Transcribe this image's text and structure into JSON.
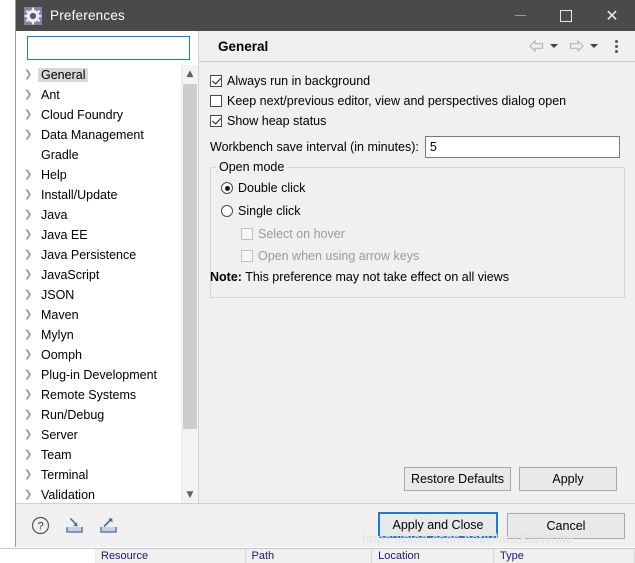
{
  "window": {
    "title": "Preferences",
    "icon": "gear-icon",
    "controls": {
      "minimize": "minimize-icon",
      "maximize": "maximize-icon",
      "close": "close-icon"
    }
  },
  "sidebar": {
    "filter": {
      "value": "",
      "placeholder": ""
    },
    "items": [
      {
        "label": "General",
        "expandable": true,
        "selected": true
      },
      {
        "label": "Ant",
        "expandable": true,
        "selected": false
      },
      {
        "label": "Cloud Foundry",
        "expandable": true,
        "selected": false
      },
      {
        "label": "Data Management",
        "expandable": true,
        "selected": false
      },
      {
        "label": "Gradle",
        "expandable": false,
        "selected": false
      },
      {
        "label": "Help",
        "expandable": true,
        "selected": false
      },
      {
        "label": "Install/Update",
        "expandable": true,
        "selected": false
      },
      {
        "label": "Java",
        "expandable": true,
        "selected": false
      },
      {
        "label": "Java EE",
        "expandable": true,
        "selected": false
      },
      {
        "label": "Java Persistence",
        "expandable": true,
        "selected": false
      },
      {
        "label": "JavaScript",
        "expandable": true,
        "selected": false
      },
      {
        "label": "JSON",
        "expandable": true,
        "selected": false
      },
      {
        "label": "Maven",
        "expandable": true,
        "selected": false
      },
      {
        "label": "Mylyn",
        "expandable": true,
        "selected": false
      },
      {
        "label": "Oomph",
        "expandable": true,
        "selected": false
      },
      {
        "label": "Plug-in Development",
        "expandable": true,
        "selected": false
      },
      {
        "label": "Remote Systems",
        "expandable": true,
        "selected": false
      },
      {
        "label": "Run/Debug",
        "expandable": true,
        "selected": false
      },
      {
        "label": "Server",
        "expandable": true,
        "selected": false
      },
      {
        "label": "Team",
        "expandable": true,
        "selected": false
      },
      {
        "label": "Terminal",
        "expandable": true,
        "selected": false
      },
      {
        "label": "Validation",
        "expandable": true,
        "selected": false
      }
    ],
    "scrollbar": {
      "up_arrow": "chevron-up-icon",
      "down_arrow": "chevron-down-icon"
    }
  },
  "page": {
    "title": "General",
    "nav": {
      "back": "back-arrow-icon",
      "back_menu": "chevron-down-icon",
      "forward": "forward-arrow-icon",
      "forward_menu": "chevron-down-icon",
      "menu": "kebab-menu-icon"
    },
    "checkboxes": [
      {
        "label": "Always run in background",
        "checked": true,
        "enabled": true
      },
      {
        "label": "Keep next/previous editor, view and perspectives dialog open",
        "checked": false,
        "enabled": true
      },
      {
        "label": "Show heap status",
        "checked": true,
        "enabled": true
      }
    ],
    "save_interval": {
      "label": "Workbench save interval (in minutes):",
      "value": "5"
    },
    "open_mode": {
      "legend": "Open mode",
      "radios": [
        {
          "label": "Double click",
          "selected": true
        },
        {
          "label": "Single click",
          "selected": false
        }
      ],
      "sub_checkboxes": [
        {
          "label": "Select on hover",
          "checked": false,
          "enabled": false
        },
        {
          "label": "Open when using arrow keys",
          "checked": false,
          "enabled": false
        }
      ],
      "note_prefix": "Note:",
      "note_text": "This preference may not take effect on all views"
    },
    "buttons": {
      "restore_defaults": "Restore Defaults",
      "apply": "Apply"
    }
  },
  "footer": {
    "icons": [
      {
        "name": "help-icon",
        "glyph": "?"
      },
      {
        "name": "import-icon",
        "glyph": "import"
      },
      {
        "name": "export-icon",
        "glyph": "export"
      }
    ],
    "apply_and_close": "Apply and Close",
    "cancel": "Cancel"
  },
  "background": {
    "table_columns": [
      "Resource",
      "Path",
      "Location",
      "Type"
    ],
    "watermark": "https://blog.csdn.net/BlackBtuWhite"
  },
  "colors": {
    "titlebar": "#4a4a4a",
    "panel": "#f0f0f0",
    "focus_blue": "#1e7ad4",
    "selection_gray": "#d8d8d8",
    "disabled_text": "#9a9a9a"
  }
}
